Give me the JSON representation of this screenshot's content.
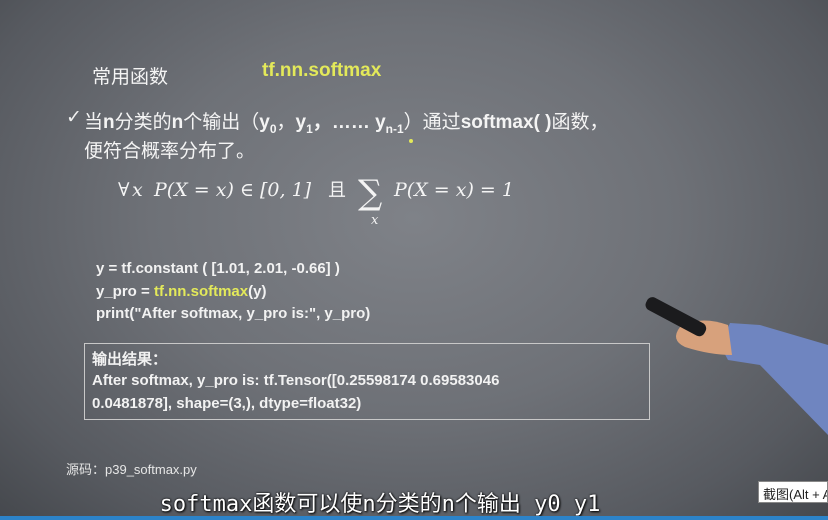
{
  "header": {
    "title": "常用函数",
    "function_name": "tf.nn.softmax"
  },
  "bullet": {
    "check": "✓",
    "text_a": "当",
    "n1": "n",
    "text_b": "分类的",
    "n2": "n",
    "text_c": "个输出（",
    "y0": "y",
    "sub0": "0",
    "sep1": "，",
    "y1": "y",
    "sub1": "1",
    "dots": "，…… ",
    "yn": "y",
    "subn": "n-1",
    "text_d": "）通过",
    "softmax": "softmax( )",
    "text_e": "函数，",
    "line2": "便符合概率分布了。"
  },
  "formula": {
    "forall": "∀",
    "var": "x",
    "prob": "P(X = x) ∈ [0, 1]",
    "and": "且",
    "sum": "∑",
    "sum_sub": "x",
    "sum_expr": "P(X = x) = 1"
  },
  "code": {
    "line1": "y = tf.constant ( [1.01, 2.01, -0.66] )",
    "line2_a": "y_pro = ",
    "line2_hl": "tf.nn.softmax",
    "line2_b": "(y)",
    "line3": "print(\"After softmax, y_pro is:\", y_pro)"
  },
  "output": {
    "label": "输出结果：",
    "line1": "After softmax, y_pro is: tf.Tensor([0.25598174  0.69583046",
    "line2": "0.0481878], shape=(3,), dtype=float32)"
  },
  "source": "源码：p39_softmax.py",
  "subtitle": "softmax函数可以使n分类的n个输出 y0  y1",
  "tooltip": "截图(Alt + A)",
  "colors": {
    "highlight": "#e3e95a",
    "text": "#f4f4f4",
    "progress": "#2c83c9"
  }
}
